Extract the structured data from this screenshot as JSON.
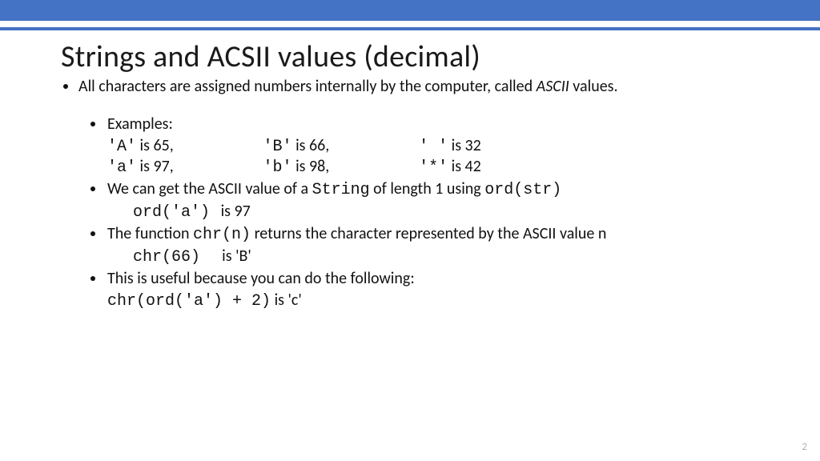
{
  "title": "Strings and ACSII values (decimal)",
  "main": {
    "intro_pre": "All characters are assigned numbers internally by the computer, called ",
    "intro_em": "ASCII",
    "intro_post": " values."
  },
  "examples": {
    "label": "Examples:",
    "row1": {
      "c1a": "'A'",
      "c1b": " is 65,",
      "c2a": "'B'",
      "c2b": " is 66,",
      "c3a": "' '",
      "c3b": " is 32"
    },
    "row2": {
      "c1a": "'a'",
      "c1b": " is 97,",
      "c2a": "'b'",
      "c2b": " is 98,",
      "c3a": "'*'",
      "c3b": " is 42"
    }
  },
  "ord": {
    "pre": "We can get the ASCII value of a ",
    "string_kw": "String",
    "mid": " of length 1 using ",
    "func": "ord(str)",
    "ex_code": "ord('a')",
    "ex_res": "   is 97"
  },
  "chr": {
    "pre": "The function ",
    "func": "chr(n)",
    "post": " returns the character represented by the ASCII value n",
    "ex_code": "chr(66)",
    "ex_res": "      is 'B'"
  },
  "useful": {
    "line": "This is useful because you can do the following:",
    "ex_code": "chr(ord('a') + 2)",
    "ex_res": " is 'c'"
  },
  "page_num": "2"
}
